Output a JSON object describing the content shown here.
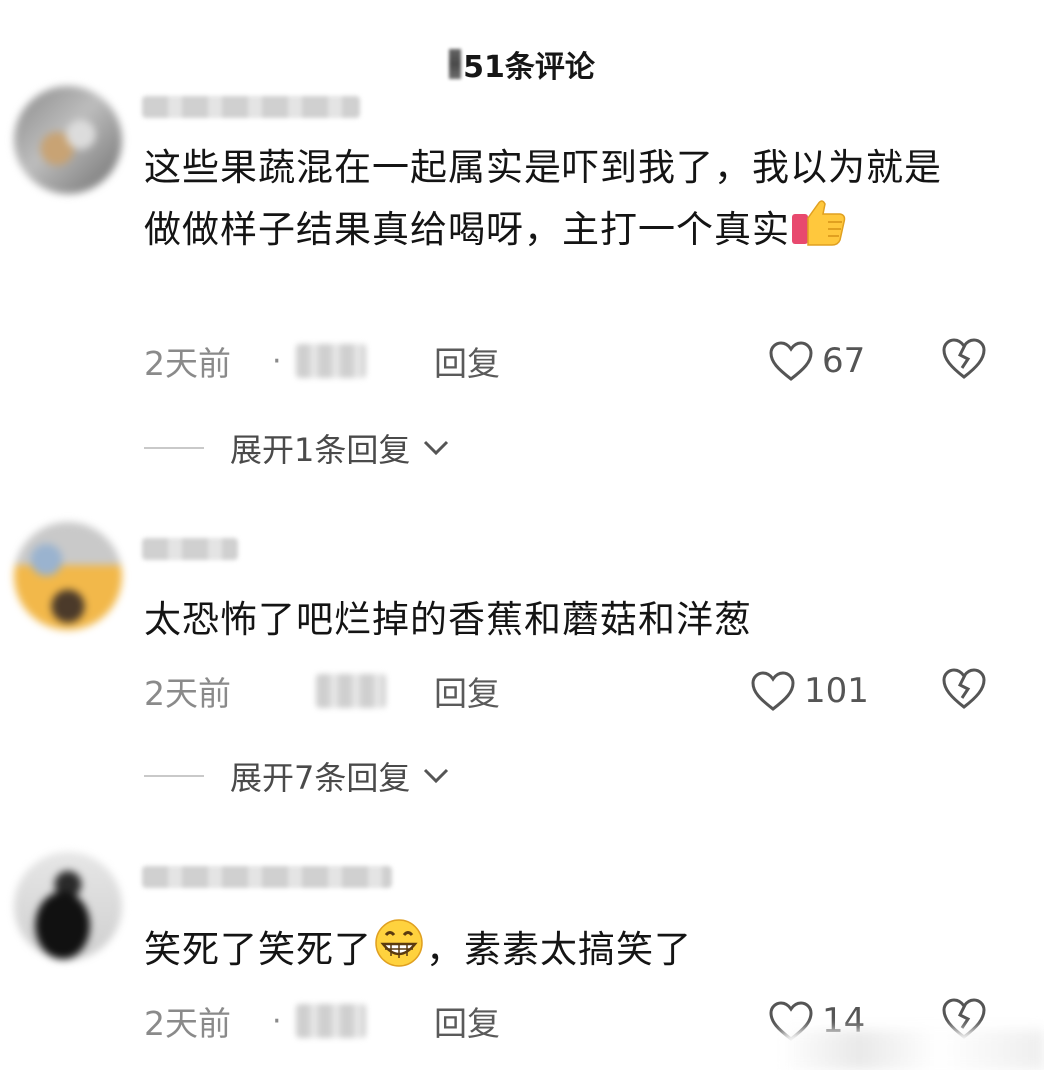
{
  "header": {
    "title": "51条评论"
  },
  "comments": [
    {
      "text": "这些果蔬混在一起属实是吓到我了，我以为就是做做样子结果真给喝呀，主打一个真实",
      "emoji": "thumbs-up-icon",
      "time": "2天前",
      "dot": "·",
      "reply_label": "回复",
      "likes": "67",
      "expand_label": "展开1条回复"
    },
    {
      "text": "太恐怖了吧烂掉的香蕉和蘑菇和洋葱",
      "time": "2天前",
      "reply_label": "回复",
      "likes": "101",
      "expand_label": "展开7条回复"
    },
    {
      "text_before": "笑死了笑死了",
      "emoji": "grinning-face-icon",
      "text_after": "，素素太搞笑了",
      "time": "2天前",
      "dot": "·",
      "reply_label": "回复",
      "likes": "14"
    }
  ]
}
